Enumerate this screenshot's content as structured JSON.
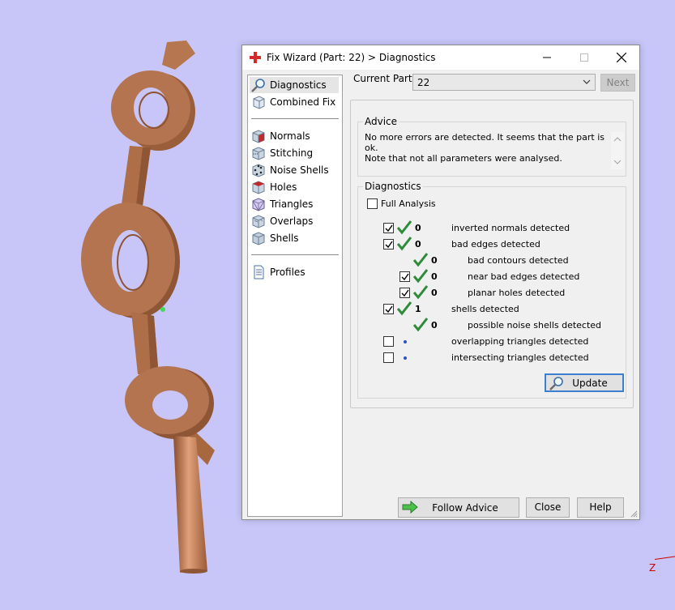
{
  "window": {
    "title": "Fix Wizard (Part: 22) > Diagnostics",
    "icon": "red-cross-icon"
  },
  "nav": {
    "groups": [
      [
        {
          "label": "Diagnostics",
          "icon": "magnifier-icon",
          "selected": true
        },
        {
          "label": "Combined Fix",
          "icon": "cube-outline-icon"
        }
      ],
      [
        {
          "label": "Normals",
          "icon": "cube-normals-icon"
        },
        {
          "label": "Stitching",
          "icon": "cube-stitch-icon"
        },
        {
          "label": "Noise Shells",
          "icon": "cube-noise-icon"
        },
        {
          "label": "Holes",
          "icon": "cube-holes-icon"
        },
        {
          "label": "Triangles",
          "icon": "cube-triangles-icon"
        },
        {
          "label": "Overlaps",
          "icon": "cube-overlaps-icon"
        },
        {
          "label": "Shells",
          "icon": "cube-shells-icon"
        }
      ],
      [
        {
          "label": "Profiles",
          "icon": "document-icon"
        }
      ]
    ]
  },
  "current_part": {
    "label": "Current Part:",
    "value": "22",
    "next_label": "Next"
  },
  "advice": {
    "title": "Advice",
    "text_line1": "No more errors are detected. It seems that the part is ok.",
    "text_line2": "Note that not all parameters were analysed."
  },
  "diagnostics": {
    "title": "Diagnostics",
    "full_analysis_label": "Full Analysis",
    "full_analysis_checked": false,
    "rows": [
      {
        "checked": true,
        "status": "ok",
        "count": "0",
        "label": "inverted normals detected",
        "indent": 0
      },
      {
        "checked": true,
        "status": "ok",
        "count": "0",
        "label": "bad edges detected",
        "indent": 0
      },
      {
        "checked": null,
        "status": "ok",
        "count": "0",
        "label": "bad contours detected",
        "indent": 1
      },
      {
        "checked": true,
        "status": "ok",
        "count": "0",
        "label": "near bad edges detected",
        "indent": 1
      },
      {
        "checked": true,
        "status": "ok",
        "count": "0",
        "label": "planar holes detected",
        "indent": 1
      },
      {
        "checked": true,
        "status": "ok",
        "count": "1",
        "label": "shells detected",
        "indent": 0
      },
      {
        "checked": null,
        "status": "ok",
        "count": "0",
        "label": "possible noise shells detected",
        "indent": 1
      },
      {
        "checked": false,
        "status": "pending",
        "count": "",
        "label": "overlapping triangles detected",
        "indent": 0
      },
      {
        "checked": false,
        "status": "pending",
        "count": "",
        "label": "intersecting triangles detected",
        "indent": 0
      }
    ],
    "update_label": "Update"
  },
  "buttons": {
    "follow_advice": "Follow Advice",
    "close": "Close",
    "help": "Help"
  },
  "viewport": {
    "axis_label": "Z",
    "model_color": "#b0704a"
  },
  "colors": {
    "background": "#c8c6f8",
    "check_green": "#2e8b3a",
    "pending_dot": "#2d4fbf",
    "focus_blue": "#3c7fcf"
  }
}
